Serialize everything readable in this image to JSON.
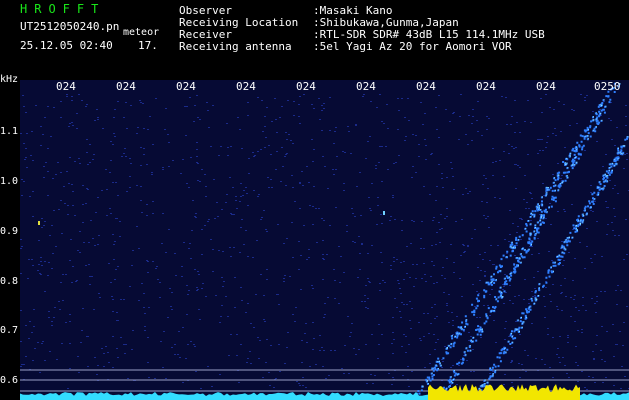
{
  "header": {
    "program": "HROFFT",
    "filename": "UT2512050240.pn",
    "file_suffix": "meteor",
    "datetime": "25.12.05 02:40",
    "sequence": "17.",
    "fields": [
      {
        "label": "Observer",
        "value": ":Masaki Kano"
      },
      {
        "label": "Receiving Location",
        "value": ":Shibukawa,Gunma,Japan"
      },
      {
        "label": "Receiver",
        "value": ":RTL-SDR SDR# 43dB L15 114.1MHz USB"
      },
      {
        "label": "Receiving antenna",
        "value": ":5el Yagi Az 20 for Aomori VOR"
      }
    ]
  },
  "plot": {
    "yunit": "kHz",
    "yticks": [
      "1.1",
      "1.0",
      "0.9",
      "0.8",
      "0.7",
      "0.6"
    ],
    "xticks": [
      "024",
      "024",
      "024",
      "024",
      "024",
      "024",
      "024",
      "024",
      "024",
      "0250"
    ],
    "colors": {
      "background": "#060a34",
      "noise": "#1a2a8a",
      "trace": "#2f7fff",
      "trace_bright": "#8fe8ff",
      "baseline": "#33ddff",
      "yellow": "#f2e600"
    }
  }
}
